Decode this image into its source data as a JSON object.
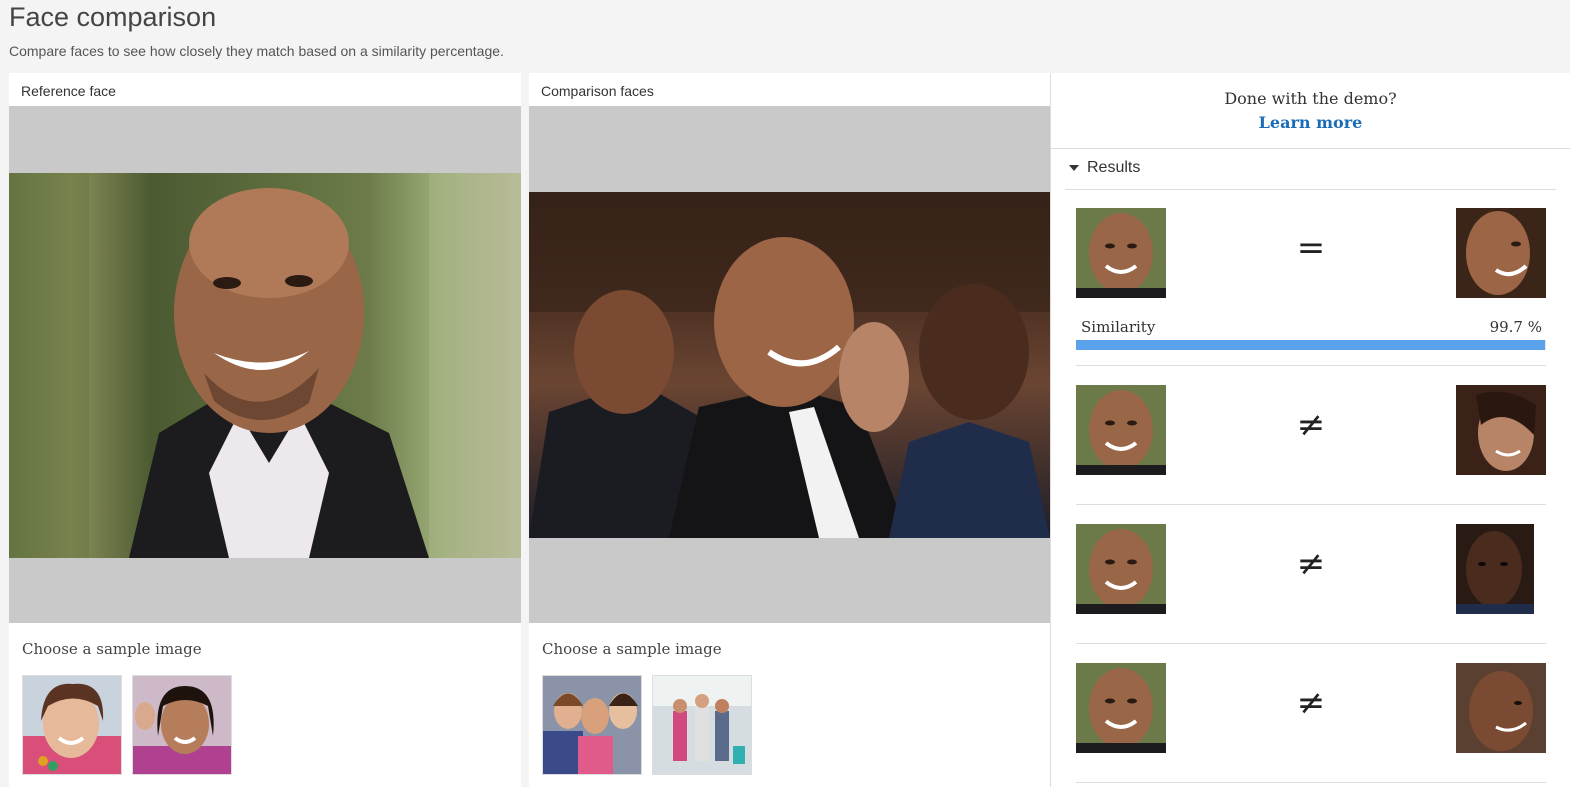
{
  "header": {
    "title": "Face comparison",
    "subtitle": "Compare faces to see how closely they match based on a similarity percentage."
  },
  "reference": {
    "label": "Reference face",
    "sample_label": "Choose a sample image"
  },
  "comparison": {
    "label": "Comparison faces",
    "sample_label": "Choose a sample image"
  },
  "results_panel": {
    "done_text": "Done with the demo?",
    "learn_more": "Learn more",
    "results_header": "Results",
    "similarity_label": "Similarity",
    "similarity_value": "99.7 %",
    "similarity_fraction": 0.997,
    "rows": [
      {
        "operator": "=",
        "match": true
      },
      {
        "operator": "≠",
        "match": false
      },
      {
        "operator": "≠",
        "match": false
      },
      {
        "operator": "≠",
        "match": false
      }
    ]
  },
  "colors": {
    "accent_link": "#1a6bb8",
    "similarity_bar": "#5aa3ec",
    "image_placeholder": "#c9c9c9"
  }
}
